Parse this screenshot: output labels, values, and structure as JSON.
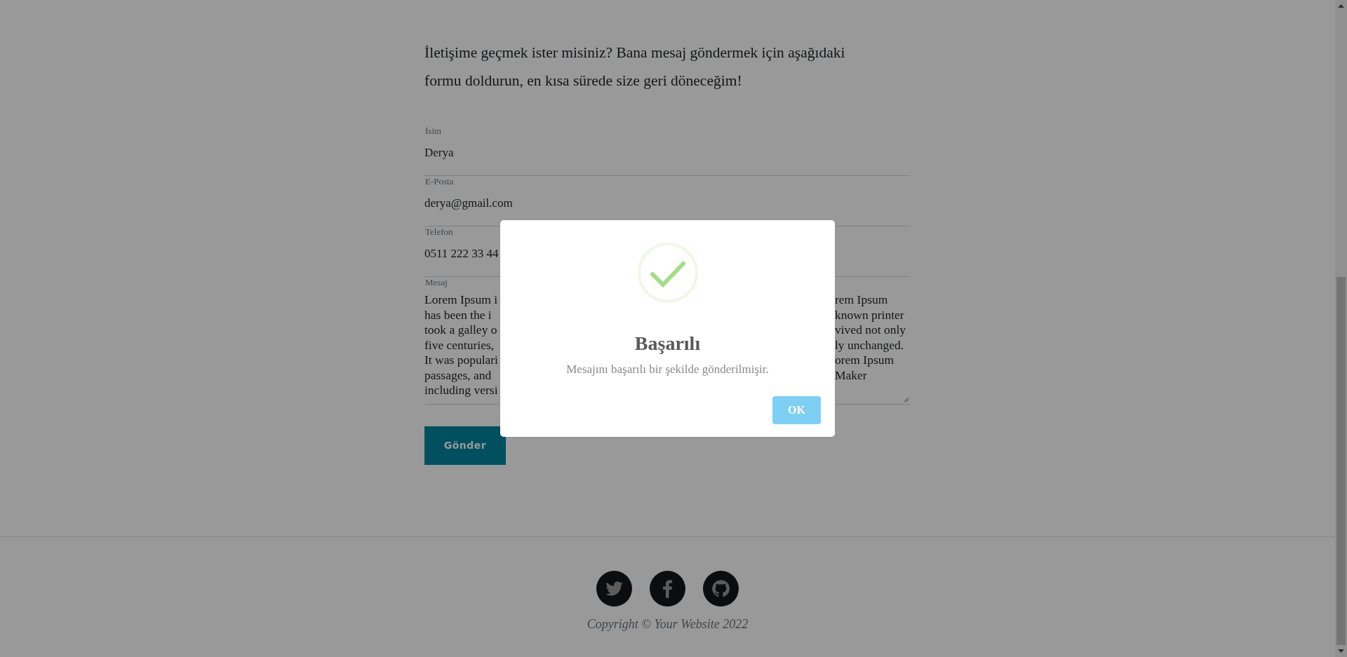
{
  "intro": "İletişime geçmek ister misiniz? Bana mesaj göndermek için aşağıdaki formu doldurun, en kısa sürede size geri döneceğim!",
  "form": {
    "fields": [
      {
        "label": "İsim",
        "value": "Derya"
      },
      {
        "label": "E-Posta",
        "value": "derya@gmail.com"
      },
      {
        "label": "Telefon",
        "value": "0511 222 33 44"
      }
    ],
    "message": {
      "label": "Mesaj",
      "lines": [
        {
          "left": "Lorem Ipsum i",
          "right": "rem Ipsum"
        },
        {
          "left": "has been the i",
          "right": "known printer"
        },
        {
          "left": "took a galley o",
          "right": "vived not only"
        },
        {
          "left": "five centuries,",
          "right": "ly unchanged."
        },
        {
          "left": "It was populari",
          "right": "orem Ipsum"
        },
        {
          "left": "passages, and",
          "right": "Maker"
        },
        {
          "left": "including versi"
        }
      ]
    },
    "submit": "Gönder"
  },
  "footer": {
    "social": [
      {
        "kind": "twitter"
      },
      {
        "kind": "facebook"
      },
      {
        "kind": "github"
      }
    ],
    "copyright": "Copyright © Your Website 2022"
  },
  "dialog": {
    "title": "Başarılı",
    "message": "Mesajını başarılı bir şekilde gönderilmişir.",
    "button": "OK"
  }
}
